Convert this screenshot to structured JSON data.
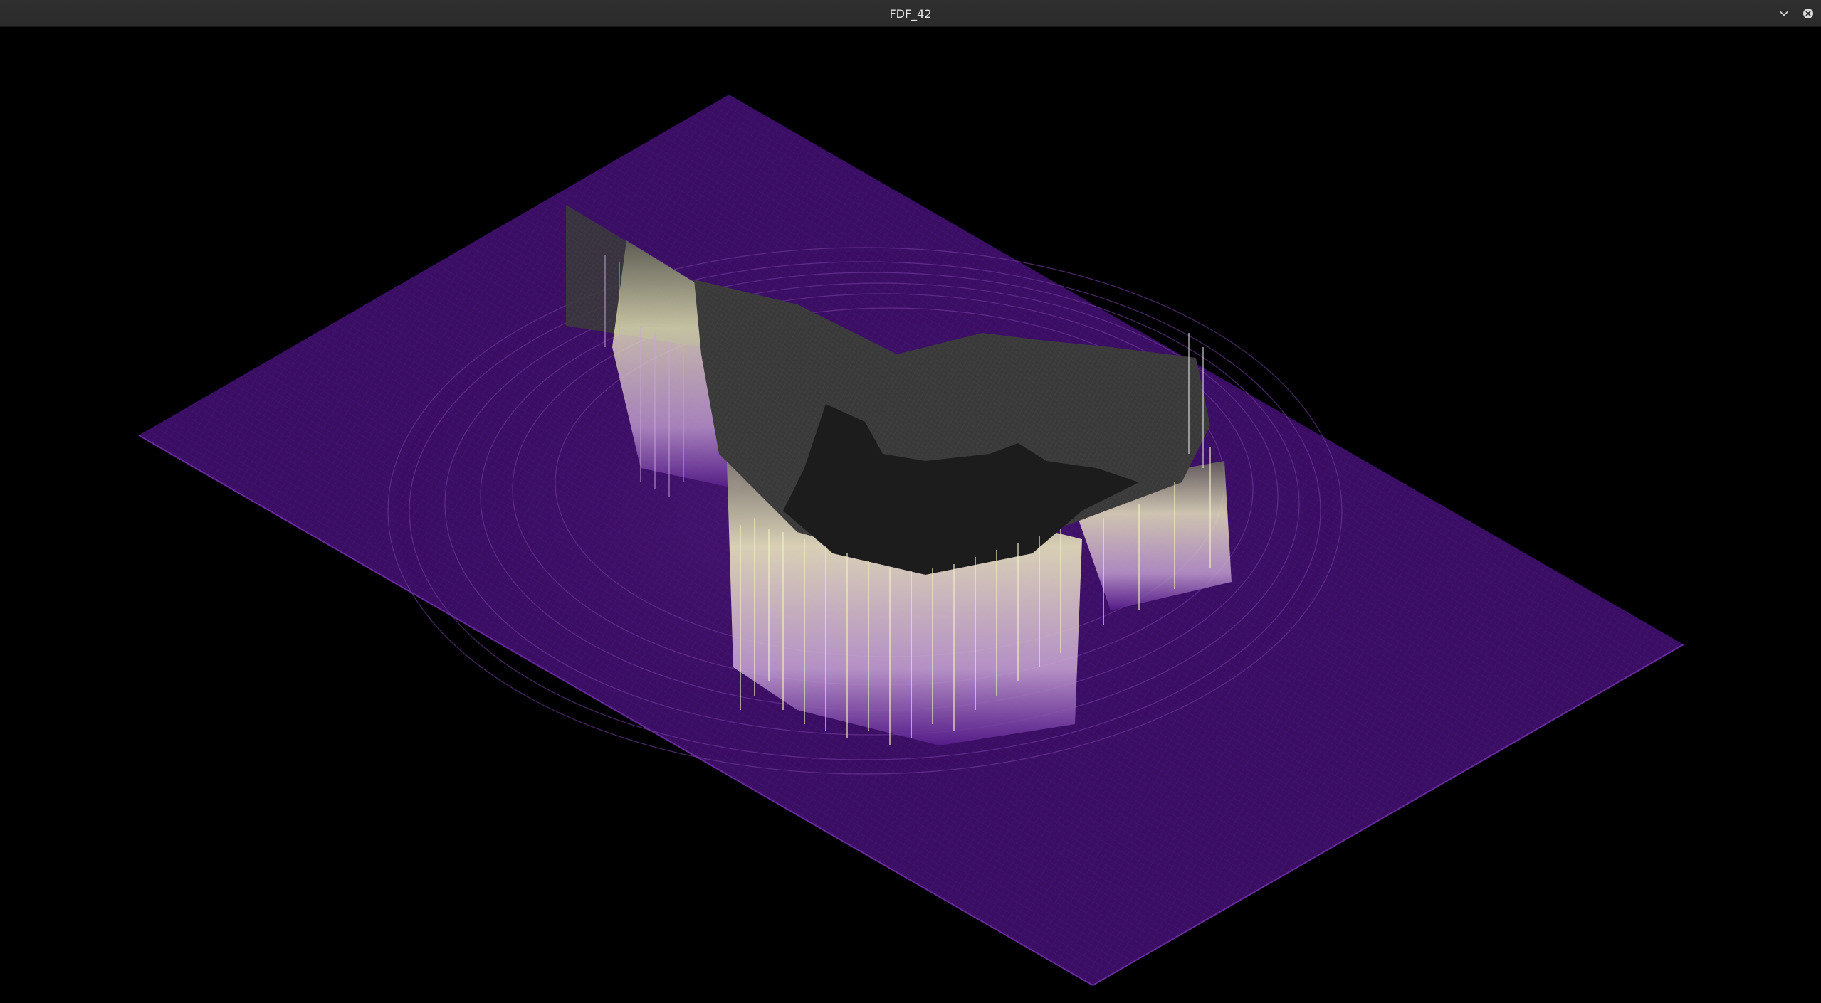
{
  "window": {
    "title": "FDF_42",
    "icons": {
      "menu": "chevron-down-icon",
      "close": "close-icon"
    }
  },
  "render": {
    "projection": "isometric",
    "colors": {
      "background": "#000000",
      "plane": "#3a0e63",
      "plane_grid": "#5a1e8f",
      "mid_height": "#c9a6d6",
      "high_peaks": "#f2f0c2",
      "plateau": "#2a2a2a"
    }
  }
}
